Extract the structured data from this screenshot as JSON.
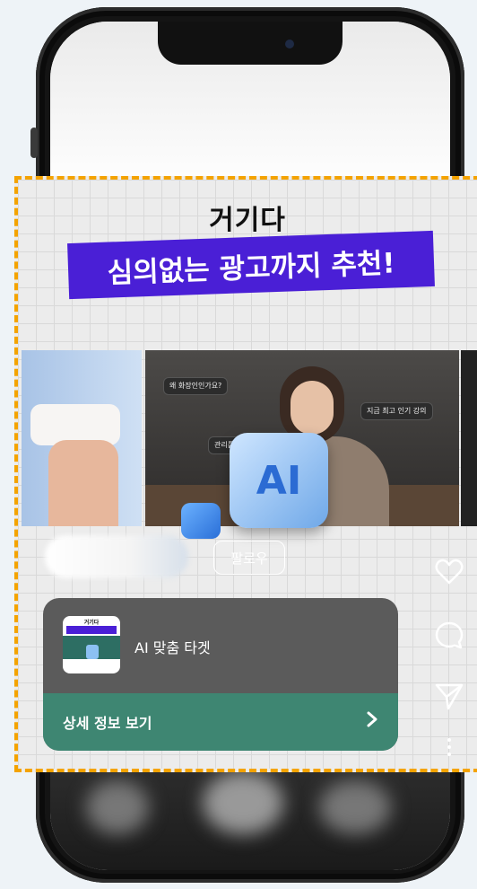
{
  "ad": {
    "headline_top": "거기다",
    "headline_banner": "심의없는 광고까지 추천!",
    "ai_label": "AI",
    "chips": [
      "왜 화장인인가요?",
      "지금 최고 인기 강의",
      "관리를 쉽게..."
    ],
    "follow_label": "팔로우"
  },
  "card": {
    "thumb_title": "거기다",
    "title": "AI 맞춤 타겟",
    "cta_label": "상세 정보 보기"
  },
  "actions": {
    "icons": [
      "heart-icon",
      "comment-icon",
      "send-icon",
      "more-icon"
    ]
  },
  "colors": {
    "highlight_border": "#f4a300",
    "banner_bg": "#4a1fd6",
    "cta_bg": "#3e8672"
  }
}
